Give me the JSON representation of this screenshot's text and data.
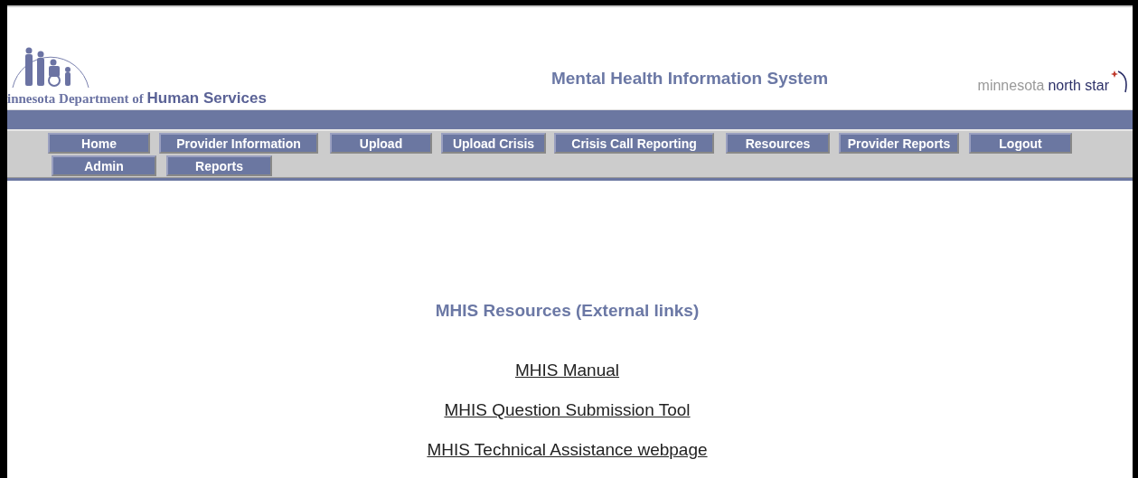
{
  "header": {
    "agency": "innesota Department of",
    "agency_bold": "Human Services",
    "title": "Mental Health Information System",
    "brand_light": "minnesota",
    "brand_dark": "north star"
  },
  "nav": [
    [
      "Home",
      "Provider Information",
      "Upload",
      "Upload Crisis",
      "Crisis Call Reporting",
      "Resources",
      "Provider Reports",
      "Logout"
    ],
    [
      "Admin",
      "Reports"
    ]
  ],
  "content": {
    "heading": "MHIS Resources (External links)",
    "links": [
      "MHIS Manual",
      "MHIS Question Submission Tool",
      "MHIS Technical Assistance webpage"
    ]
  }
}
